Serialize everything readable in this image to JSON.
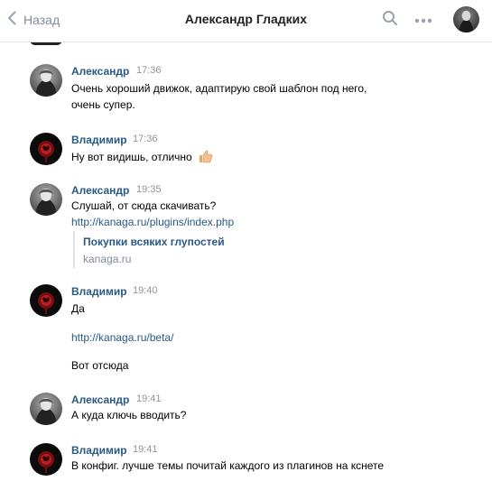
{
  "header": {
    "back_label": "Назад",
    "title": "Александр Гладких"
  },
  "colors": {
    "link": "#2a5885",
    "time": "#939393",
    "muted": "#828a99",
    "divider": "#e7e8ec"
  },
  "messages": [
    {
      "author": "Александр",
      "time": "17:36",
      "lines": [
        "Очень хороший движок, адаптирую свой шаблон под него,",
        "очень супер."
      ]
    },
    {
      "author": "Владимир",
      "time": "17:36",
      "lines": [
        "Ну вот видишь, отлично"
      ],
      "emoji": "thumbs-up-icon"
    },
    {
      "author": "Александр",
      "time": "19:35",
      "lines": [
        "Слушай, от сюда скачивать?"
      ],
      "link": "http://kanaga.ru/plugins/index.php",
      "snippet": {
        "title": "Покупки всяких глупостей",
        "domain": "kanaga.ru"
      }
    },
    {
      "author": "Владимир",
      "time": "19:40",
      "lines": [
        "Да"
      ],
      "link": "http://kanaga.ru/beta/",
      "after_link": "Вот отсюда"
    },
    {
      "author": "Александр",
      "time": "19:41",
      "lines": [
        "А куда ключь вводить?"
      ]
    },
    {
      "author": "Владимир",
      "time": "19:41",
      "lines": [
        "В конфиг. лучше темы почитай каждого из плагинов на кснете"
      ]
    }
  ]
}
